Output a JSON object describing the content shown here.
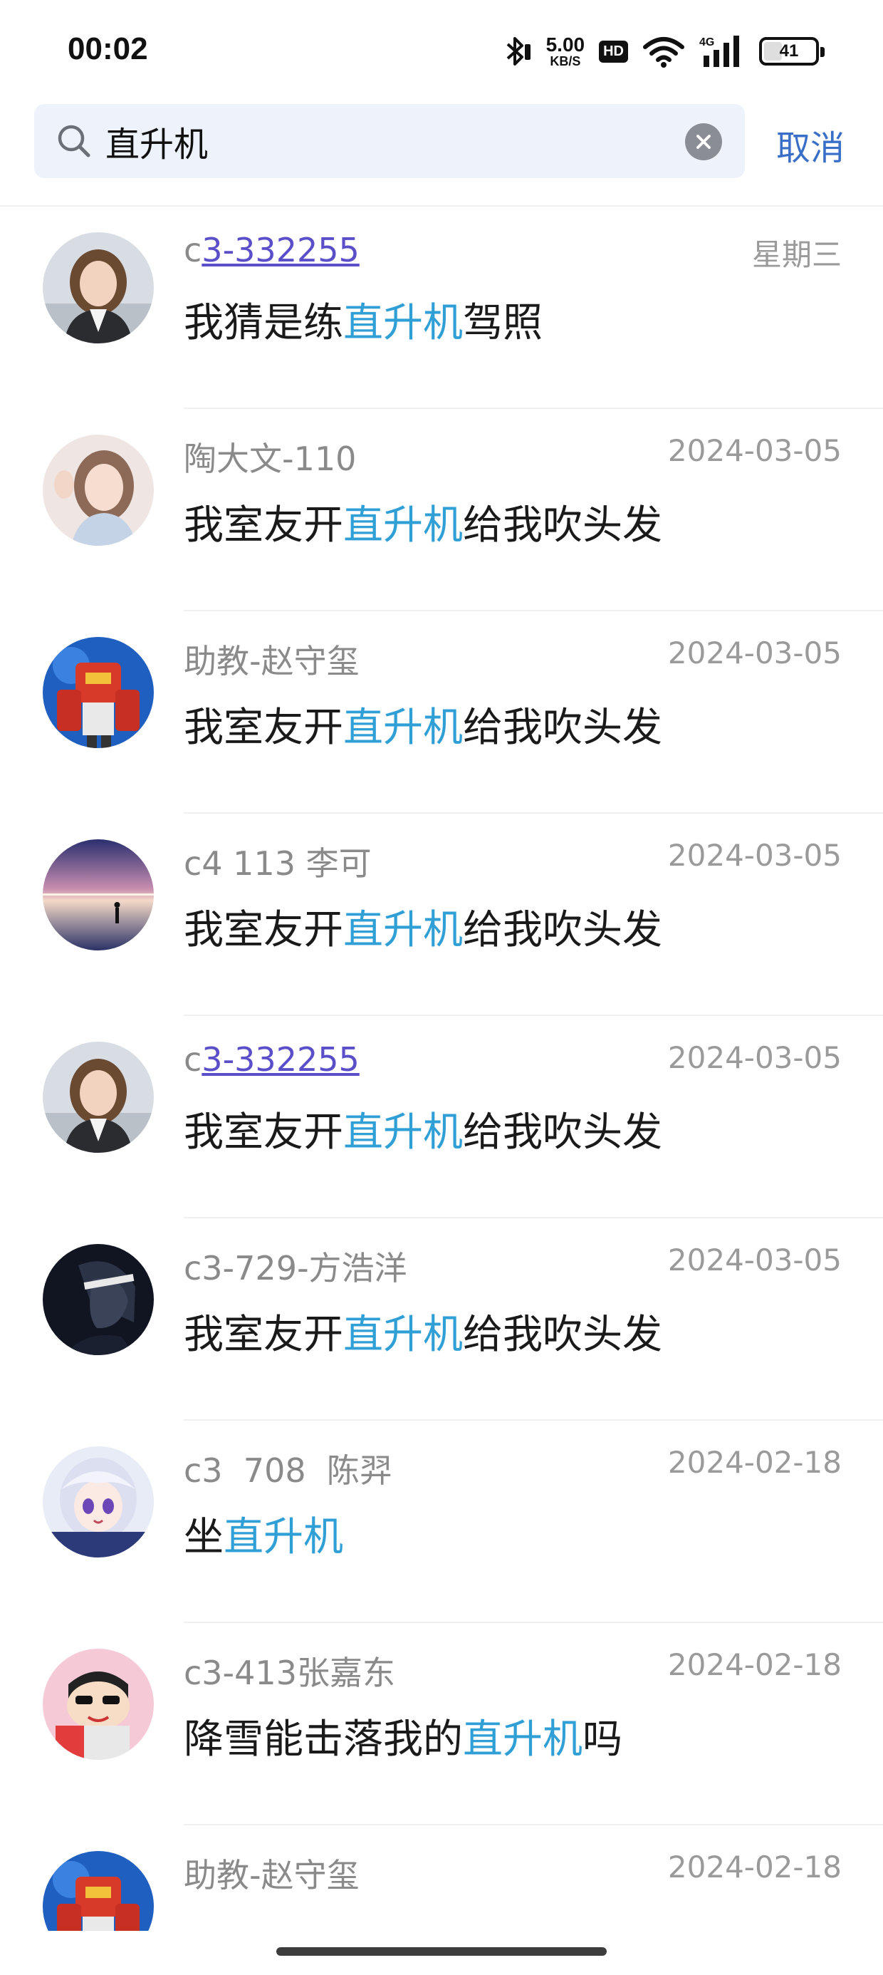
{
  "status_bar": {
    "time": "00:02",
    "net_speed_value": "5.00",
    "net_speed_unit": "KB/S",
    "hd_label": "HD",
    "battery_level": 41,
    "battery_text": "41",
    "icons": [
      "bluetooth-icon",
      "hd-icon",
      "wifi-icon",
      "signal-4g-icon",
      "battery-icon"
    ]
  },
  "search": {
    "query": "直升机",
    "cancel_label": "取消",
    "icons": [
      "search-icon",
      "clear-icon"
    ]
  },
  "accent_colors": {
    "highlight": "#2f9fd6",
    "link": "#5b4ec9",
    "cancel": "#3a6fc7"
  },
  "results": [
    {
      "name_prefix": "c",
      "name_link": "3-332255",
      "name": "",
      "date": "星期三",
      "msg_before": "我猜是练",
      "msg_highlight": "直升机",
      "msg_after": "驾照",
      "avatar": "girl-photo-avatar"
    },
    {
      "name_prefix": "",
      "name_link": "",
      "name": "陶大文-110",
      "date": "2024-03-05",
      "msg_before": "我室友开",
      "msg_highlight": "直升机",
      "msg_after": "给我吹头发",
      "avatar": "waving-girl-avatar"
    },
    {
      "name_prefix": "",
      "name_link": "",
      "name": "助教-赵守玺",
      "date": "2024-03-05",
      "msg_before": "我室友开",
      "msg_highlight": "直升机",
      "msg_after": "给我吹头发",
      "avatar": "robot-avatar"
    },
    {
      "name_prefix": "",
      "name_link": "",
      "name": "c4 113 李可",
      "date": "2024-03-05",
      "msg_before": "我室友开",
      "msg_highlight": "直升机",
      "msg_after": "给我吹头发",
      "avatar": "night-sky-avatar"
    },
    {
      "name_prefix": "c",
      "name_link": "3-332255",
      "name": "",
      "date": "2024-03-05",
      "msg_before": "我室友开",
      "msg_highlight": "直升机",
      "msg_after": "给我吹头发",
      "avatar": "girl-photo-avatar"
    },
    {
      "name_prefix": "",
      "name_link": "",
      "name": "c3-729-方浩洋",
      "date": "2024-03-05",
      "msg_before": "我室友开",
      "msg_highlight": "直升机",
      "msg_after": "给我吹头发",
      "avatar": "dark-anime-avatar"
    },
    {
      "name_prefix": "",
      "name_link": "",
      "name": "c3  708  陈羿",
      "date": "2024-02-18",
      "msg_before": "坐",
      "msg_highlight": "直升机",
      "msg_after": "",
      "avatar": "anime-girl-avatar"
    },
    {
      "name_prefix": "",
      "name_link": "",
      "name": "c3-413张嘉东",
      "date": "2024-02-18",
      "msg_before": "降雪能击落我的",
      "msg_highlight": "直升机",
      "msg_after": "吗",
      "avatar": "cartoon-boy-avatar"
    },
    {
      "name_prefix": "",
      "name_link": "",
      "name": "助教-赵守玺",
      "date": "2024-02-18",
      "msg_before": "",
      "msg_highlight": "",
      "msg_after": "",
      "avatar": "robot-avatar"
    }
  ]
}
